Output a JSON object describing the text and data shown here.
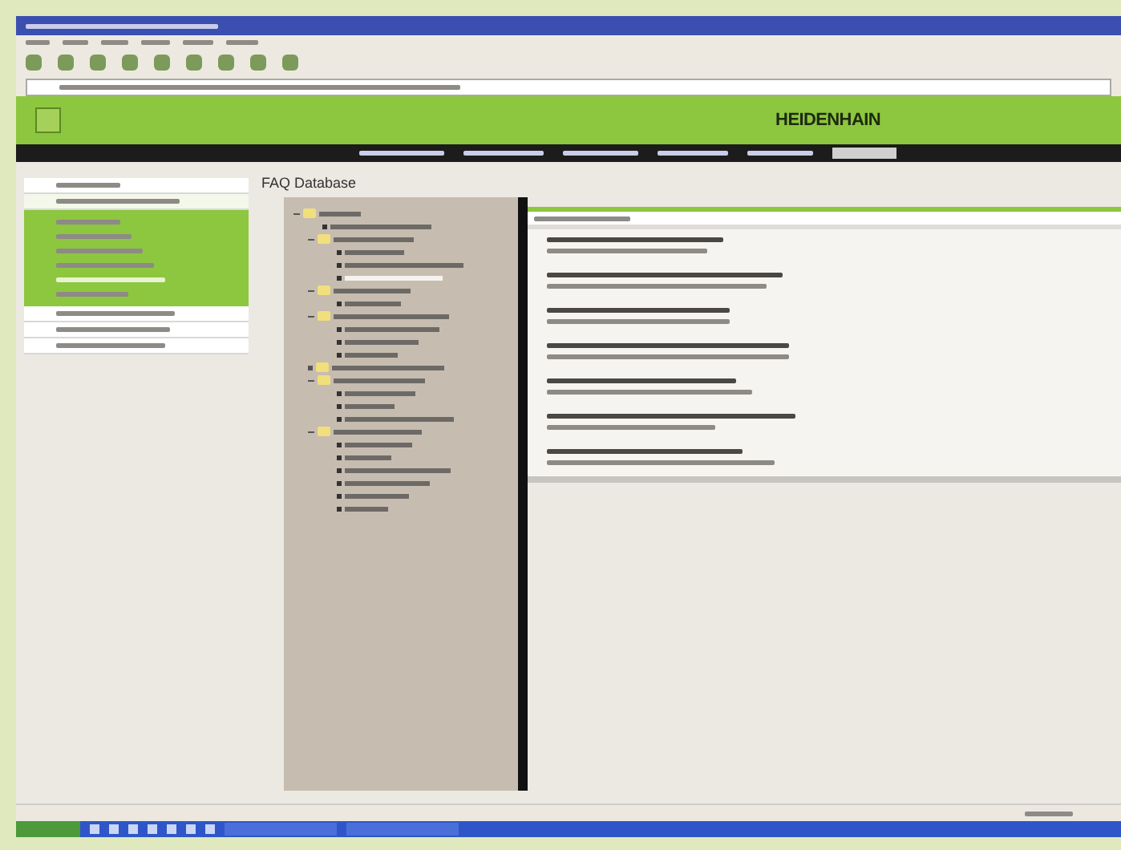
{
  "header": {
    "logo": "HEIDENHAIN"
  },
  "sidebar": {
    "items": [
      {
        "expanded": false
      },
      {
        "expanded": true,
        "children": [
          {
            "selected": false
          },
          {
            "selected": false
          },
          {
            "selected": false
          },
          {
            "selected": false
          },
          {
            "selected": true
          },
          {
            "selected": false
          }
        ]
      },
      {
        "expanded": false
      },
      {
        "expanded": false
      },
      {
        "expanded": false
      }
    ]
  },
  "content": {
    "title": "FAQ Database"
  },
  "tree": [
    {
      "kind": "folder",
      "expanded": true,
      "children": [
        {
          "kind": "page",
          "selected": false
        },
        {
          "kind": "folder",
          "expanded": true,
          "children": [
            {
              "kind": "page",
              "selected": false
            },
            {
              "kind": "page",
              "selected": false
            },
            {
              "kind": "page",
              "selected": true
            }
          ]
        },
        {
          "kind": "folder",
          "expanded": true,
          "children": [
            {
              "kind": "page",
              "selected": false
            }
          ]
        },
        {
          "kind": "folder",
          "expanded": true,
          "children": [
            {
              "kind": "page",
              "selected": false
            },
            {
              "kind": "page",
              "selected": false
            },
            {
              "kind": "page",
              "selected": false
            }
          ]
        },
        {
          "kind": "folder",
          "expanded": false
        },
        {
          "kind": "folder",
          "expanded": true,
          "children": [
            {
              "kind": "page",
              "selected": false
            },
            {
              "kind": "page",
              "selected": false
            },
            {
              "kind": "page",
              "selected": false
            }
          ]
        },
        {
          "kind": "folder",
          "expanded": true,
          "children": [
            {
              "kind": "page",
              "selected": false
            },
            {
              "kind": "page",
              "selected": false
            },
            {
              "kind": "page",
              "selected": false
            },
            {
              "kind": "page",
              "selected": false
            },
            {
              "kind": "page",
              "selected": false
            },
            {
              "kind": "page",
              "selected": false
            }
          ]
        }
      ]
    }
  ],
  "faq_entries": [
    {
      "kind": "entry"
    },
    {
      "kind": "entry"
    },
    {
      "kind": "entry"
    },
    {
      "kind": "entry"
    },
    {
      "kind": "entry"
    },
    {
      "kind": "entry"
    },
    {
      "kind": "entry"
    }
  ]
}
